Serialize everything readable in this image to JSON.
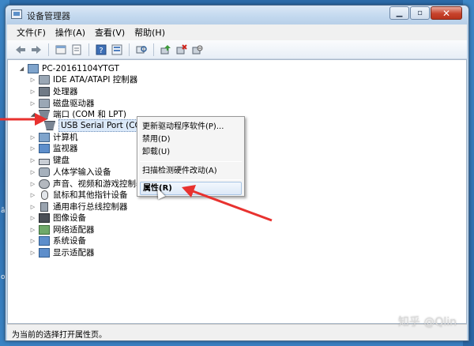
{
  "window": {
    "title": "设备管理器",
    "controls": {
      "minimize": "▁",
      "maximize": "▫",
      "close": "✕"
    }
  },
  "menubar": {
    "items": [
      "文件(F)",
      "操作(A)",
      "查看(V)",
      "帮助(H)"
    ]
  },
  "toolbar": {
    "buttons": [
      "back-icon",
      "forward-icon",
      "properties-icon",
      "show-hide-icon",
      "help-icon",
      "details-icon",
      "scan-icon",
      "update-driver-icon",
      "disable-icon",
      "uninstall-icon"
    ]
  },
  "tree": {
    "root": "PC-20161104YTGT",
    "items": [
      "IDE ATA/ATAPI 控制器",
      "处理器",
      "磁盘驱动器",
      "端口 (COM 和 LPT)",
      "USB Serial Port (COM7)",
      "计算机",
      "监视器",
      "键盘",
      "人体学输入设备",
      "声音、视频和游戏控制器",
      "鼠标和其他指针设备",
      "通用串行总线控制器",
      "图像设备",
      "网络适配器",
      "系统设备",
      "显示适配器"
    ]
  },
  "context_menu": {
    "items": [
      "更新驱动程序软件(P)...",
      "禁用(D)",
      "卸载(U)",
      "扫描检测硬件改动(A)",
      "属性(R)"
    ]
  },
  "statusbar": {
    "text": "为当前的选择打开属性页。"
  },
  "desktop": {
    "left_text_1": "ā0",
    "left_text_2": "o"
  },
  "watermark": "知乎 @Qlin",
  "colors": {
    "arrow": "#e8322f",
    "selection": "#dbe9f9"
  }
}
